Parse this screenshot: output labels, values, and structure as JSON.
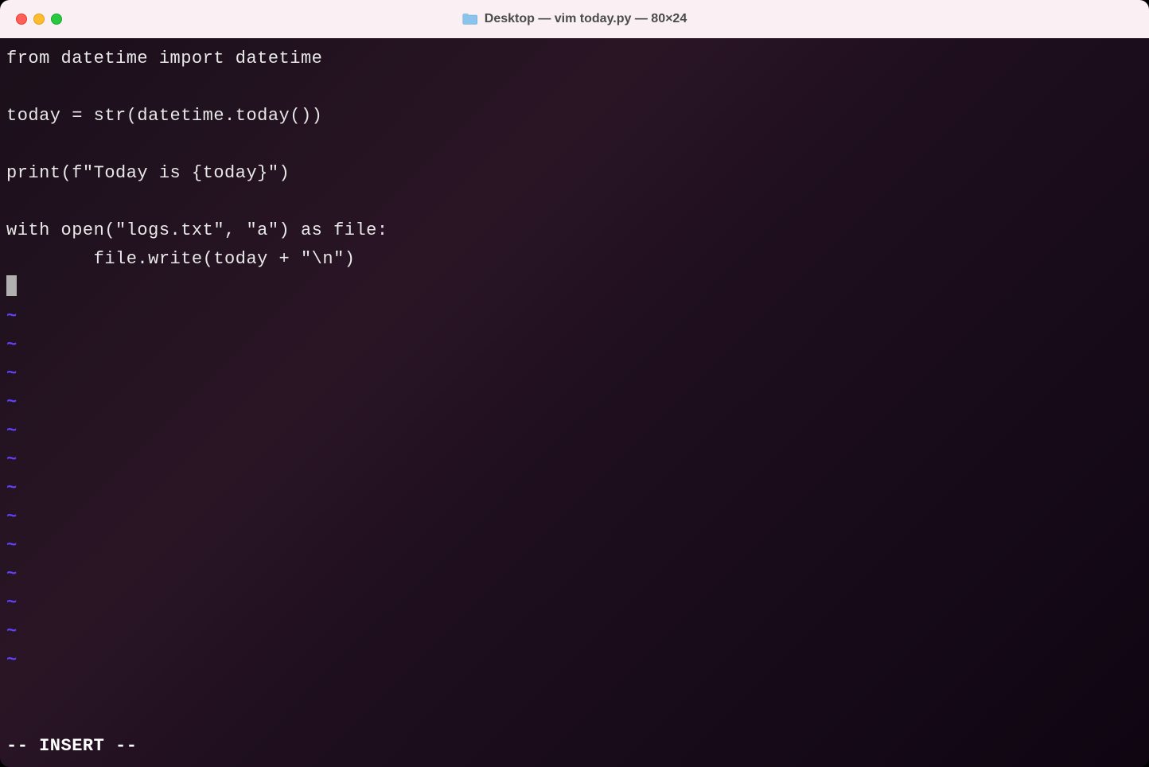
{
  "titlebar": {
    "title": "Desktop — vim today.py — 80×24"
  },
  "editor": {
    "lines": [
      "from datetime import datetime",
      "",
      "today = str(datetime.today())",
      "",
      "print(f\"Today is {today}\")",
      "",
      "with open(\"logs.txt\", \"a\") as file:",
      "        file.write(today + \"\\n\")"
    ],
    "tilde_char": "~",
    "tilde_count": 13,
    "status": "-- INSERT --"
  }
}
